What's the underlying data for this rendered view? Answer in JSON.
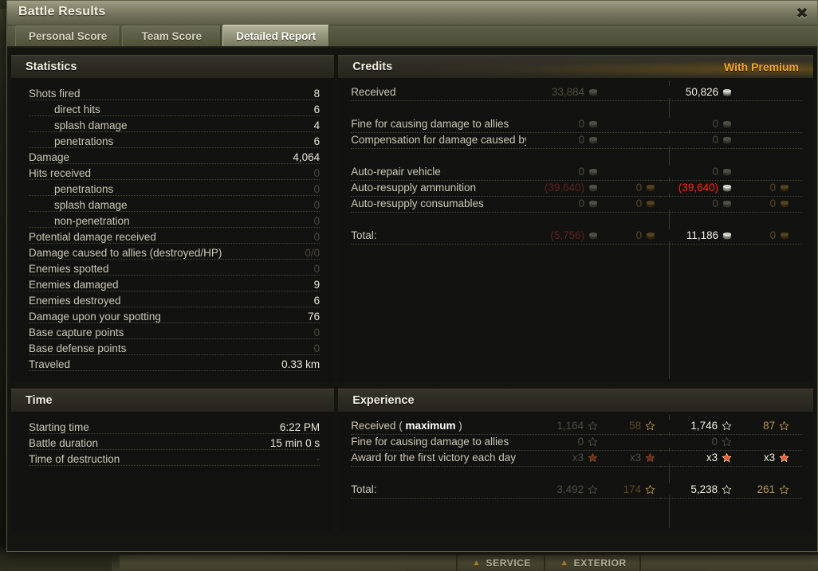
{
  "window": {
    "title": "Battle Results",
    "close_label": "✖"
  },
  "tabs": [
    {
      "label": "Personal Score",
      "active": false
    },
    {
      "label": "Team Score",
      "active": false
    },
    {
      "label": "Detailed Report",
      "active": true
    }
  ],
  "statistics": {
    "title": "Statistics",
    "rows": [
      {
        "label": "Shots fired",
        "value": "8",
        "indent": false,
        "dim": false
      },
      {
        "label": "direct hits",
        "value": "6",
        "indent": true,
        "dim": false
      },
      {
        "label": "splash damage",
        "value": "4",
        "indent": true,
        "dim": false
      },
      {
        "label": "penetrations",
        "value": "6",
        "indent": true,
        "dim": false
      },
      {
        "label": "Damage",
        "value": "4,064",
        "indent": false,
        "dim": false
      },
      {
        "label": "Hits received",
        "value": "0",
        "indent": false,
        "dim": true
      },
      {
        "label": "penetrations",
        "value": "0",
        "indent": true,
        "dim": true
      },
      {
        "label": "splash damage",
        "value": "0",
        "indent": true,
        "dim": true
      },
      {
        "label": "non-penetration",
        "value": "0",
        "indent": true,
        "dim": true
      },
      {
        "label": "Potential damage received",
        "value": "0",
        "indent": false,
        "dim": true
      },
      {
        "label": "Damage caused to allies (destroyed/HP)",
        "value": "0/0",
        "indent": false,
        "dim": true
      },
      {
        "label": "Enemies spotted",
        "value": "0",
        "indent": false,
        "dim": true
      },
      {
        "label": "Enemies damaged",
        "value": "9",
        "indent": false,
        "dim": false
      },
      {
        "label": "Enemies destroyed",
        "value": "6",
        "indent": false,
        "dim": false
      },
      {
        "label": "Damage upon your spotting",
        "value": "76",
        "indent": false,
        "dim": false
      },
      {
        "label": "Base capture points",
        "value": "0",
        "indent": false,
        "dim": true
      },
      {
        "label": "Base defense points",
        "value": "0",
        "indent": false,
        "dim": true
      },
      {
        "label": "Traveled",
        "value": "0.33 km",
        "indent": false,
        "dim": false
      }
    ]
  },
  "credits": {
    "title": "Credits",
    "premium_label": "With Premium",
    "rows": [
      {
        "label": "Received",
        "base_credits": "33,884",
        "base_credits_style": "dim",
        "base_gold": "",
        "base_gold_style": "",
        "prem_credits": "50,826",
        "prem_credits_style": "bright",
        "prem_gold": "",
        "prem_gold_style": "",
        "gap_after": true
      },
      {
        "label": "Fine for causing damage to allies",
        "base_credits": "0",
        "base_credits_style": "dim",
        "base_gold": "",
        "base_gold_style": "",
        "prem_credits": "0",
        "prem_credits_style": "dim",
        "prem_gold": "",
        "prem_gold_style": ""
      },
      {
        "label": "Compensation for damage caused by allies",
        "base_credits": "0",
        "base_credits_style": "dim",
        "base_gold": "",
        "base_gold_style": "",
        "prem_credits": "0",
        "prem_credits_style": "dim",
        "prem_gold": "",
        "prem_gold_style": "",
        "gap_after": true
      },
      {
        "label": "Auto-repair vehicle",
        "base_credits": "0",
        "base_credits_style": "dim",
        "base_gold": "",
        "base_gold_style": "",
        "prem_credits": "0",
        "prem_credits_style": "dim",
        "prem_gold": "",
        "prem_gold_style": ""
      },
      {
        "label": "Auto-resupply ammunition",
        "base_credits": "(39,640)",
        "base_credits_style": "reddim",
        "base_gold": "0",
        "base_gold_style": "golddim",
        "prem_credits": "(39,640)",
        "prem_credits_style": "red",
        "prem_gold": "0",
        "prem_gold_style": "golddim"
      },
      {
        "label": "Auto-resupply consumables",
        "base_credits": "0",
        "base_credits_style": "dim",
        "base_gold": "0",
        "base_gold_style": "golddim",
        "prem_credits": "0",
        "prem_credits_style": "dim",
        "prem_gold": "0",
        "prem_gold_style": "golddim",
        "gap_after": true
      },
      {
        "label": "Total:",
        "base_credits": "(5,756)",
        "base_credits_style": "reddim",
        "base_gold": "0",
        "base_gold_style": "golddim",
        "prem_credits": "11,186",
        "prem_credits_style": "bright",
        "prem_gold": "0",
        "prem_gold_style": "golddim"
      }
    ]
  },
  "time": {
    "title": "Time",
    "rows": [
      {
        "label": "Starting time",
        "value": "6:22 PM",
        "dim": false
      },
      {
        "label": "Battle duration",
        "value": "15 min 0 s",
        "dim": false
      },
      {
        "label": "Time of destruction",
        "value": "-",
        "dim": true
      }
    ]
  },
  "experience": {
    "title": "Experience",
    "rows": [
      {
        "label": "Received ( ",
        "label_em": "maximum",
        "label_tail": " )",
        "base_xp": "1,164",
        "base_xp_style": "dim",
        "base_xp_icon": "star-grey",
        "base_free": "58",
        "base_free_style": "golddim",
        "base_free_icon": "star-gold",
        "prem_xp": "1,746",
        "prem_xp_style": "bright",
        "prem_xp_icon": "star-white",
        "prem_free": "87",
        "prem_free_style": "gold",
        "prem_free_icon": "star-gold"
      },
      {
        "label": "Fine for causing damage to allies",
        "base_xp": "0",
        "base_xp_style": "dim",
        "base_xp_icon": "star-grey",
        "base_free": "",
        "base_free_style": "",
        "base_free_icon": "",
        "prem_xp": "0",
        "prem_xp_style": "dim",
        "prem_xp_icon": "star-grey",
        "prem_free": "",
        "prem_free_style": "",
        "prem_free_icon": ""
      },
      {
        "label": "Award for the first victory each day",
        "base_xp": "x3",
        "base_xp_style": "dim",
        "base_xp_icon": "star-red-dim",
        "base_free": "x3",
        "base_free_style": "dim",
        "base_free_icon": "star-red-dim",
        "prem_xp": "x3",
        "prem_xp_style": "bright",
        "prem_xp_icon": "star-red",
        "prem_free": "x3",
        "prem_free_style": "bright",
        "prem_free_icon": "star-red",
        "gap_after": true
      },
      {
        "label": "Total:",
        "base_xp": "3,492",
        "base_xp_style": "dim",
        "base_xp_icon": "star-grey",
        "base_free": "174",
        "base_free_style": "golddim",
        "base_free_icon": "star-gold",
        "prem_xp": "5,238",
        "prem_xp_style": "bright",
        "prem_xp_icon": "star-white",
        "prem_free": "261",
        "prem_free_style": "gold",
        "prem_free_icon": "star-gold"
      }
    ]
  },
  "background": {
    "nav_items": [
      {
        "label": "SERVICE",
        "icon": "wrench-icon"
      },
      {
        "label": "EXTERIOR",
        "icon": "paint-icon"
      }
    ]
  },
  "colors": {
    "premium_accent": "#f0a830",
    "negative": "#ff2418",
    "gold": "#b99a52",
    "bright_text": "#f1efe0",
    "dim_text": "#4f4e3f"
  }
}
